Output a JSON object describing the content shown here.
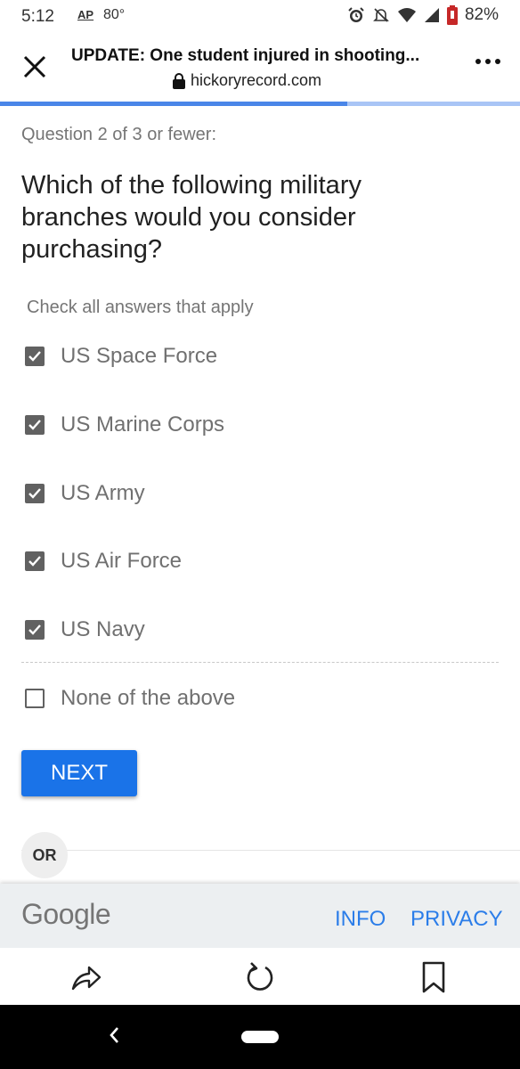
{
  "status_bar": {
    "time": "5:12",
    "ap_icon": "AP",
    "temperature": "80°",
    "battery": "82%",
    "icons": [
      "alarm-icon",
      "notifications-off-icon",
      "wifi-icon",
      "signal-icon",
      "battery-icon"
    ]
  },
  "browser": {
    "page_title": "UPDATE: One student injured in shooting...",
    "domain": "hickoryrecord.com",
    "progress_fraction": 0.667
  },
  "survey": {
    "question_count": "Question 2 of 3 or fewer:",
    "question_text": "Which of the following military branches would you consider purchasing?",
    "instruction": "Check all answers that apply",
    "options": [
      {
        "label": "US Space Force",
        "checked": true
      },
      {
        "label": "US Marine Corps",
        "checked": true
      },
      {
        "label": "US Army",
        "checked": true
      },
      {
        "label": "US Air Force",
        "checked": true
      },
      {
        "label": "US Navy",
        "checked": true
      },
      {
        "label": "None of the above",
        "checked": false
      }
    ],
    "next_label": "NEXT",
    "or_label": "OR"
  },
  "footer": {
    "logo": "Google",
    "info_label": "INFO",
    "privacy_label": "PRIVACY"
  },
  "colors": {
    "accent": "#1a73e8",
    "progress_fill": "#4a86e8",
    "progress_track": "#a9c5f6",
    "link": "#2b7de9"
  }
}
